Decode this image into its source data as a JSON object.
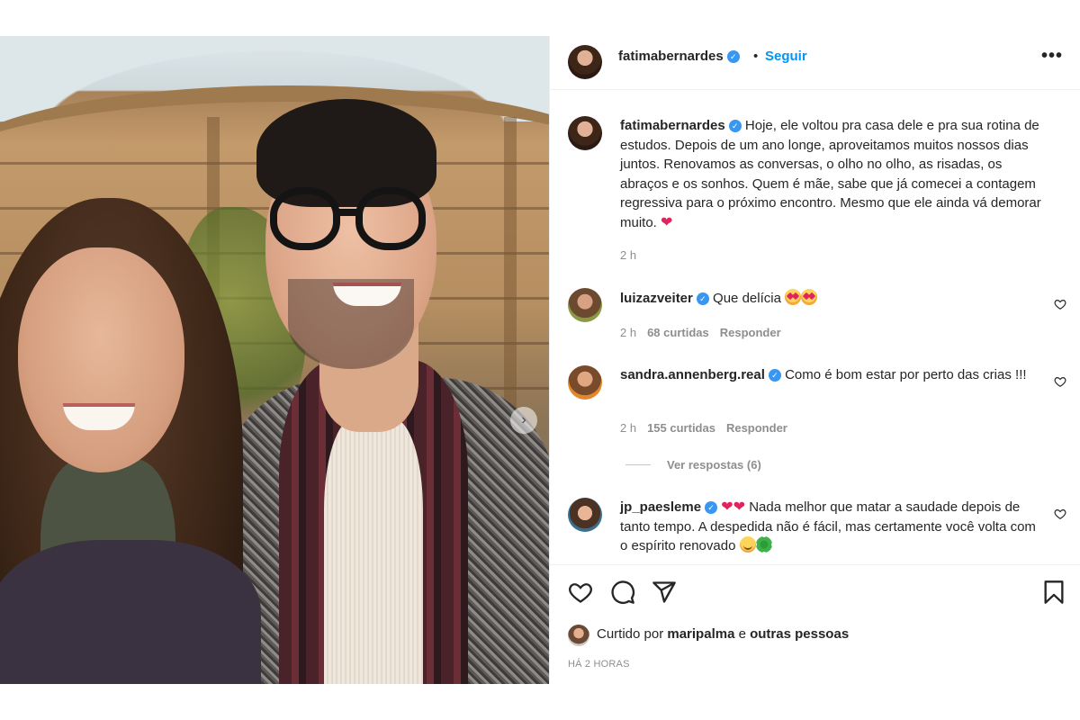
{
  "post": {
    "author": "fatimabernardes",
    "follow_label": "Seguir",
    "separator": "•",
    "more_label": "•••",
    "caption": "Hoje, ele voltou pra casa dele e pra sua rotina de estudos. Depois de um ano longe, aproveitamos muitos nossos dias juntos. Renovamos as conversas, o olho no olho, as risadas, os abraços e os sonhos. Quem é mãe, sabe que já comecei a contagem regressiva para o próximo encontro. Mesmo que ele ainda vá demorar muito.",
    "caption_time": "2 h",
    "next_icon": "›"
  },
  "comments": [
    {
      "user": "luizazveiter",
      "verified": true,
      "text": "Que delícia",
      "time": "2 h",
      "likes": "68 curtidas",
      "reply_label": "Responder"
    },
    {
      "user": "sandra.annenberg.real",
      "verified": true,
      "text": "Como é bom estar por perto das crias !!!",
      "time": "2 h",
      "likes": "155 curtidas",
      "reply_label": "Responder",
      "view_replies": "Ver respostas (6)"
    },
    {
      "user": "jp_paesleme",
      "verified": true,
      "text": "Nada melhor que matar a saudade depois de tanto tempo. A despedida não é fácil, mas certamente você volta com o espírito renovado"
    }
  ],
  "footer": {
    "liked_prefix": "Curtido por",
    "liked_user": "maripalma",
    "liked_and": "e",
    "liked_others": "outras pessoas",
    "timestamp": "HÁ 2 HORAS"
  },
  "icons": {
    "verified": "verified-badge-icon",
    "like": "heart-icon",
    "comment": "comment-icon",
    "share": "send-icon",
    "save": "bookmark-icon"
  },
  "colors": {
    "link": "#0095f6",
    "verified": "#3897f0",
    "muted": "#8e8e8e",
    "text": "#262626",
    "heart": "#e0245e"
  }
}
